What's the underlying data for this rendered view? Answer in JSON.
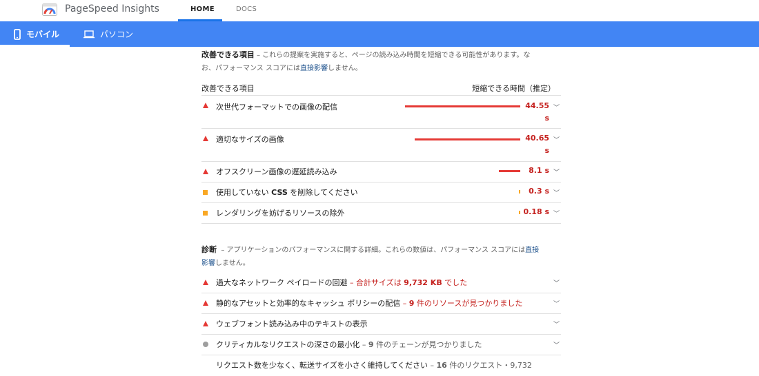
{
  "header": {
    "brand": "PageSpeed Insights",
    "nav": {
      "home": "HOME",
      "docs": "DOCS"
    }
  },
  "tabs": {
    "mobile": "モバイル",
    "pc": "パソコン"
  },
  "opportunities": {
    "title": "改善できる項目",
    "desc_line1": "– これらの提案を実施すると、ページの読み込み時間を短縮できる可能性があります。な",
    "desc_line2_pre": "お、パフォーマンス スコアには",
    "desc_link": "直接影響",
    "desc_line2_post": "しません。",
    "col_item": "改善できる項目",
    "col_time": "短縮できる時間（推定）",
    "items": [
      {
        "label": "次世代フォーマットでの画像の配信",
        "time_line1": "44.55",
        "time_line2": "s",
        "savings_s": 44.55,
        "level": "fail"
      },
      {
        "label": "適切なサイズの画像",
        "time_line1": "40.65",
        "time_line2": "s",
        "savings_s": 40.65,
        "level": "fail"
      },
      {
        "label": "オフスクリーン画像の遅延読み込み",
        "time_line1": "8.1 s",
        "savings_s": 8.1,
        "level": "fail"
      },
      {
        "label_pre": "使用していない ",
        "label_bold": "CSS",
        "label_post": " を削除してください",
        "time_line1": "0.3 s",
        "savings_s": 0.3,
        "level": "average"
      },
      {
        "label": "レンダリングを妨げるリソースの除外",
        "time_line1": "0.18 s",
        "savings_s": 0.18,
        "level": "average"
      }
    ]
  },
  "diagnostics": {
    "title": "診断",
    "desc_pre": "– アプリケーションのパフォーマンスに関する詳細。これらの数値は、パフォーマンス スコアには",
    "desc_link1": "直接",
    "desc_link2": "影響",
    "desc_post": "しません。",
    "items": [
      {
        "label": "過大なネットワーク ペイロードの回避",
        "sep": " – ",
        "detail_pre": "合計サイズは ",
        "detail_bold": "9,732 KB",
        "detail_post": " でした",
        "level": "fail"
      },
      {
        "label": "静的なアセットと効率的なキャッシュ ポリシーの配信",
        "sep": " – ",
        "detail_pre": "",
        "detail_bold": "9",
        "detail_post": " 件のリソースが見つかりました",
        "level": "fail"
      },
      {
        "label": "ウェブフォント読み込み中のテキストの表示",
        "level": "fail"
      },
      {
        "label": "クリティカルなリクエストの深さの最小化",
        "sep": " – ",
        "detail_pre": "",
        "detail_bold": "9",
        "detail_post": " 件のチェーンが見つかりました",
        "level": "info"
      },
      {
        "label": "リクエスト数を少なく、転送サイズを小さく維持してください",
        "sep": " – ",
        "detail_pre": "",
        "detail_bold": "16",
        "detail_post": " 件のリクエスト・9,732",
        "level": "none"
      }
    ]
  },
  "colors": {
    "accent": "#4285f4",
    "fail": "#e53935",
    "average": "#f9a825",
    "info": "#9e9e9e"
  }
}
